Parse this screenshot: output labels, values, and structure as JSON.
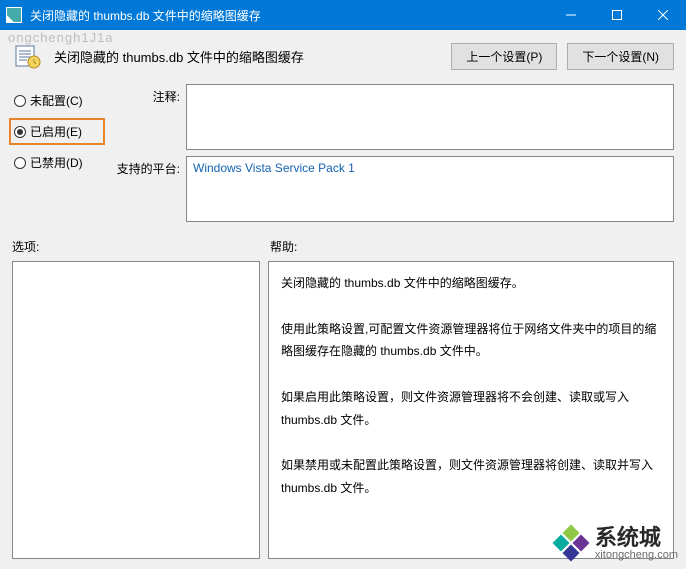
{
  "window": {
    "title": "关闭隐藏的 thumbs.db 文件中的缩略图缓存"
  },
  "header": {
    "policy_title": "关闭隐藏的 thumbs.db 文件中的缩略图缓存",
    "prev_btn": "上一个设置(P)",
    "next_btn": "下一个设置(N)"
  },
  "radios": {
    "not_configured": "未配置(C)",
    "enabled": "已启用(E)",
    "disabled": "已禁用(D)",
    "selected": "enabled"
  },
  "fields": {
    "comment_label": "注释:",
    "comment_value": "",
    "platform_label": "支持的平台:",
    "platform_value": "Windows Vista Service Pack 1"
  },
  "lower": {
    "options_label": "选项:",
    "help_label": "帮助:",
    "options_body": "",
    "help_body": "关闭隐藏的 thumbs.db 文件中的缩略图缓存。\n\n使用此策略设置,可配置文件资源管理器将位于网络文件夹中的项目的缩略图缓存在隐藏的 thumbs.db 文件中。\n\n如果启用此策略设置，则文件资源管理器将不会创建、读取或写入 thumbs.db 文件。\n\n如果禁用或未配置此策略设置，则文件资源管理器将创建、读取并写入 thumbs.db 文件。"
  },
  "watermark": {
    "brand": "系统城",
    "url": "xitongcheng.com"
  },
  "ghost": "ongchengh1J1a"
}
